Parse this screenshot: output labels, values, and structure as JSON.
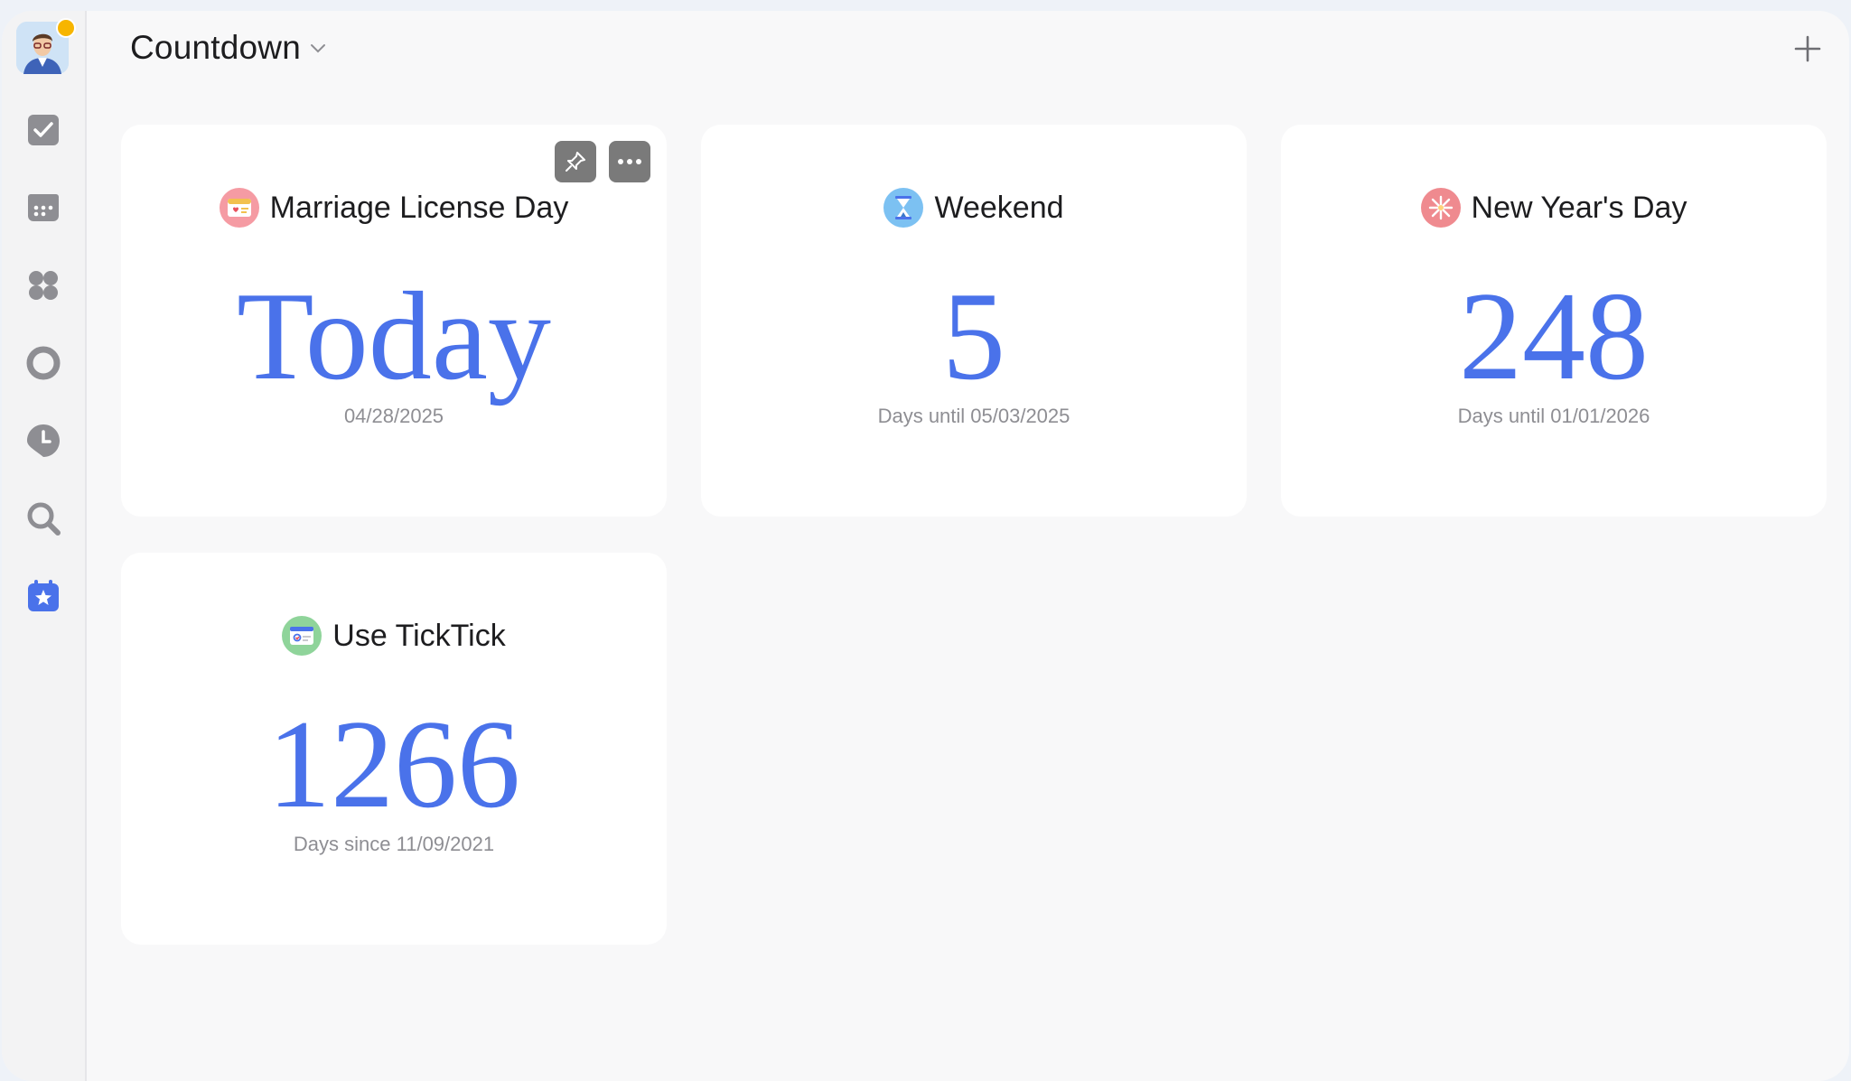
{
  "header": {
    "title": "Countdown"
  },
  "sidebar": {
    "items": [
      {
        "icon": "checkbox-icon"
      },
      {
        "icon": "calendar-icon"
      },
      {
        "icon": "apps-icon"
      },
      {
        "icon": "circle-icon"
      },
      {
        "icon": "clock-icon"
      },
      {
        "icon": "search-icon"
      },
      {
        "icon": "countdown-calendar-star-icon"
      }
    ]
  },
  "cards": [
    {
      "name": "Marriage License Day",
      "value": "Today",
      "sub": "04/28/2025",
      "icon": "card-icon"
    },
    {
      "name": "Weekend",
      "value": "5",
      "sub": "Days until 05/03/2025",
      "icon": "hourglass-icon"
    },
    {
      "name": "New Year's Day",
      "value": "248",
      "sub": "Days until 01/01/2026",
      "icon": "fireworks-icon"
    },
    {
      "name": "Use TickTick",
      "value": "1266",
      "sub": "Days since 11/09/2021",
      "icon": "app-window-icon"
    }
  ],
  "colors": {
    "accent": "#4a72ea",
    "active_nav": "#4a72ea"
  }
}
